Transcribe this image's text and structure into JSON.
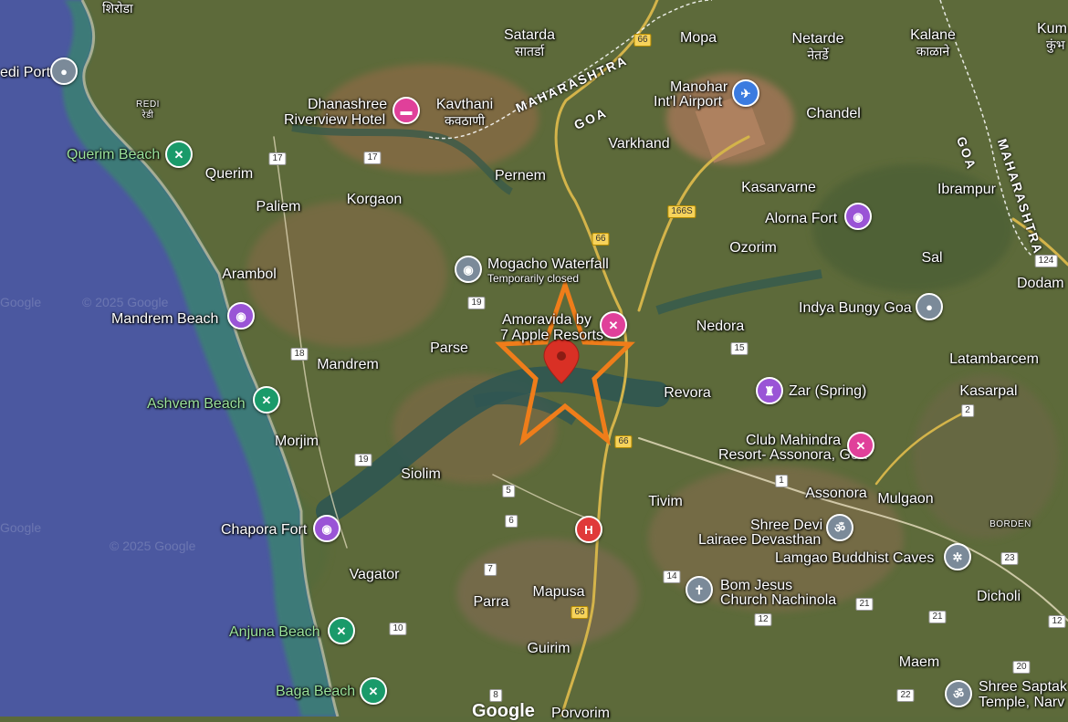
{
  "map": {
    "colors": {
      "sea": "#4a5a9e",
      "coast": "#3f7f7a",
      "land": "#5f6b3b",
      "river": "#2f5a55",
      "star": "#ef7d1a",
      "marker": "#d93025"
    },
    "watermark": "© 2025 Google",
    "watermark2": "Google",
    "logo": "Google",
    "states": {
      "maharashtra": "MAHARASHTRA",
      "goa": "GOA"
    },
    "places": {
      "shiroda": "शिरोडा",
      "redi_port": "edi Port",
      "redi_en": "REDI",
      "redi_mr": "रेडी",
      "satarda": "Satarda",
      "satarda_mr": "सातर्डा",
      "mopa": "Mopa",
      "netarde": "Netarde",
      "netarde_mr": "नेतर्डे",
      "kalane": "Kalane",
      "kalane_mr": "काळाने",
      "kum": "Kum",
      "kum_mr": "कुंभ",
      "kavthani": "Kavthani",
      "kavthani_mr": "कवठाणी",
      "manohar1": "Manohar",
      "manohar2": "Int'l Airport",
      "chandel": "Chandel",
      "varkhand": "Varkhand",
      "pernem": "Pernem",
      "querim": "Querim",
      "paliem": "Paliem",
      "korgaon": "Korgaon",
      "kasarvarne": "Kasarvarne",
      "ibrampur": "Ibrampur",
      "ozorim": "Ozorim",
      "sal": "Sal",
      "dodam": "Dodam",
      "arambol": "Arambol",
      "nedora": "Nedora",
      "parse": "Parse",
      "mandrem": "Mandrem",
      "latambarcem": "Latambarcem",
      "revora": "Revora",
      "kasarpal": "Kasarpal",
      "morjim": "Morjim",
      "siolim": "Siolim",
      "tivim": "Tivim",
      "assonora": "Assonora",
      "mulgaon": "Mulgaon",
      "borden": "BORDEN",
      "vagator": "Vagator",
      "parra": "Parra",
      "mapusa": "Mapusa",
      "dicholi": "Dicholi",
      "guirim": "Guirim",
      "maem": "Maem",
      "porvorim": "Porvorim"
    },
    "pois": {
      "dhanashree1": "Dhanashree",
      "dhanashree2": "Riverview Hotel",
      "querim_beach": "Querim Beach",
      "mogacho": "Mogacho Waterfall",
      "mogacho_status": "Temporarily closed",
      "alorna_fort": "Alorna Fort",
      "indya_bungy": "Indya Bungy Goa",
      "mandrem_beach": "Mandrem Beach",
      "amoravida1": "Amoravida by",
      "amoravida2": "7 Apple Resorts",
      "zar": "Zar (Spring)",
      "ashvem_beach": "Ashvem Beach",
      "club_mahindra1": "Club Mahindra",
      "club_mahindra2": "Resort- Assonora, Goa",
      "chapora_fort": "Chapora Fort",
      "shree_devi1": "Shree Devi",
      "shree_devi2": "Lairaee Devasthan",
      "lamgao": "Lamgao Buddhist Caves",
      "bom_jesus1": "Bom Jesus",
      "bom_jesus2": "Church Nachinola",
      "anjuna_beach": "Anjuna Beach",
      "baga_beach": "Baga Beach",
      "shree_saptak1": "Shree Saptak",
      "shree_saptak2": "Temple, Narv"
    },
    "roads": [
      "66",
      "66",
      "66",
      "66",
      "166S",
      "124",
      "17",
      "17",
      "19",
      "18",
      "19",
      "15",
      "5",
      "6",
      "7",
      "10",
      "8",
      "14",
      "12",
      "21",
      "21",
      "22",
      "20",
      "1",
      "2",
      "23",
      "12"
    ]
  }
}
